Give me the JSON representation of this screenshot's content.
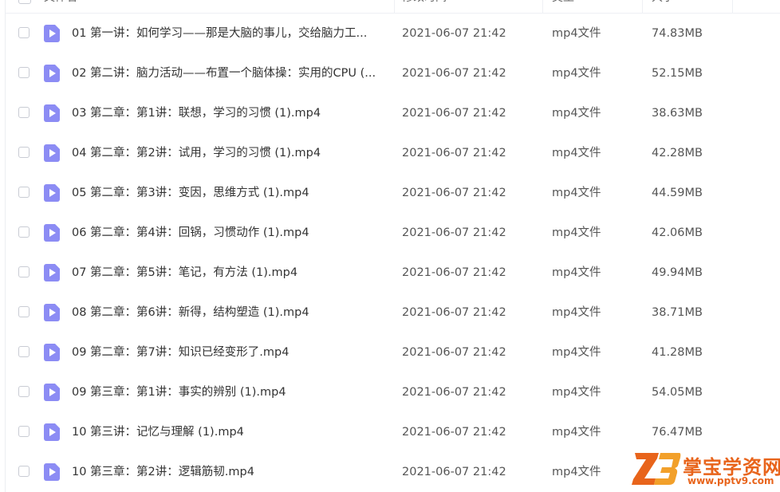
{
  "header": {
    "name_col": "文件名",
    "time_col": "修改时间",
    "type_col": "类型",
    "size_col": "大小",
    "sort_icon": "sort-down-icon"
  },
  "files": [
    {
      "name": "01 第一讲：如何学习——那是大脑的事儿，交给脑力工...",
      "time": "2021-06-07 21:42",
      "type": "mp4文件",
      "size": "74.83MB"
    },
    {
      "name": "02 第二讲：脑力活动——布置一个脑体操：实用的CPU (...",
      "time": "2021-06-07 21:42",
      "type": "mp4文件",
      "size": "52.15MB"
    },
    {
      "name": "03 第二章：第1讲：联想，学习的习惯 (1).mp4",
      "time": "2021-06-07 21:42",
      "type": "mp4文件",
      "size": "38.63MB"
    },
    {
      "name": "04 第二章：第2讲：试用，学习的习惯 (1).mp4",
      "time": "2021-06-07 21:42",
      "type": "mp4文件",
      "size": "42.28MB"
    },
    {
      "name": "05 第二章：第3讲：变因，思维方式 (1).mp4",
      "time": "2021-06-07 21:42",
      "type": "mp4文件",
      "size": "44.59MB"
    },
    {
      "name": "06 第二章：第4讲：回锅，习惯动作 (1).mp4",
      "time": "2021-06-07 21:42",
      "type": "mp4文件",
      "size": "42.06MB"
    },
    {
      "name": "07 第二章：第5讲：笔记，有方法 (1).mp4",
      "time": "2021-06-07 21:42",
      "type": "mp4文件",
      "size": "49.94MB"
    },
    {
      "name": "08 第二章：第6讲：新得，结构塑造 (1).mp4",
      "time": "2021-06-07 21:42",
      "type": "mp4文件",
      "size": "38.71MB"
    },
    {
      "name": "09 第二章：第7讲：知识已经变形了.mp4",
      "time": "2021-06-07 21:42",
      "type": "mp4文件",
      "size": "41.28MB"
    },
    {
      "name": "09 第三章：第1讲：事实的辨别 (1).mp4",
      "time": "2021-06-07 21:42",
      "type": "mp4文件",
      "size": "54.05MB"
    },
    {
      "name": "10 第三讲：记忆与理解 (1).mp4",
      "time": "2021-06-07 21:42",
      "type": "mp4文件",
      "size": "76.47MB"
    },
    {
      "name": "10 第三章：第2讲：逻辑筋韧.mp4",
      "time": "2021-06-07 21:42",
      "type": "mp4文件",
      "size": ""
    }
  ],
  "icons": {
    "file": "video-file-icon",
    "checkbox": "checkbox-icon"
  },
  "colors": {
    "file_icon": "#8c8cf4",
    "watermark": "#e8641b",
    "sort_accent": "#4a7ef5"
  },
  "watermark": {
    "logo_text": "Z3",
    "title": "掌宝学资网",
    "url": "www.pptv9.com"
  }
}
